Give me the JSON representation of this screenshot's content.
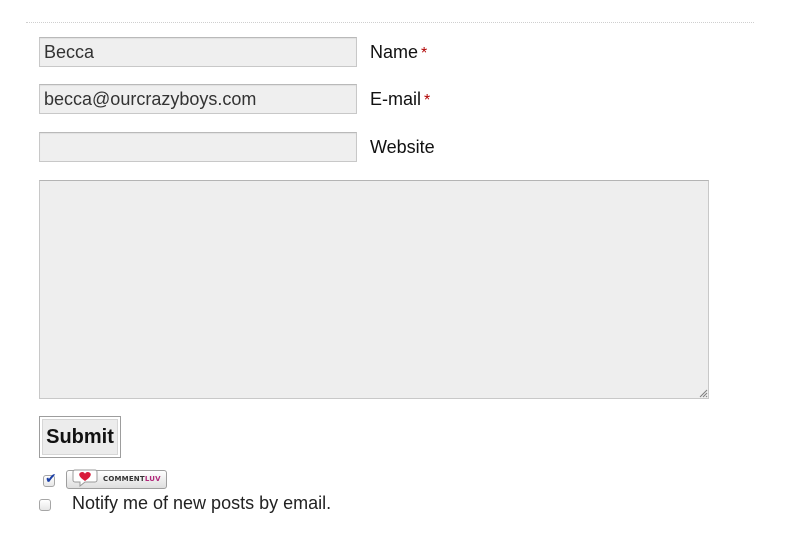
{
  "form": {
    "name": {
      "value": "Becca",
      "label": "Name",
      "required_mark": "*"
    },
    "email": {
      "value": "becca@ourcrazyboys.com",
      "label": "E-mail",
      "required_mark": "*"
    },
    "website": {
      "value": "",
      "label": "Website"
    },
    "comment": {
      "value": ""
    },
    "submit_label": "Submit"
  },
  "commentluv": {
    "checked": true,
    "badge_text_main": "COMMENT",
    "badge_text_accent": "LUV",
    "icon": "heart-speech-bubble-icon",
    "accent_color": "#d81b3a"
  },
  "notify": {
    "checked": false,
    "label": "Notify me of new posts by email."
  },
  "colors": {
    "required": "#b00000",
    "field_background": "#efefef"
  }
}
